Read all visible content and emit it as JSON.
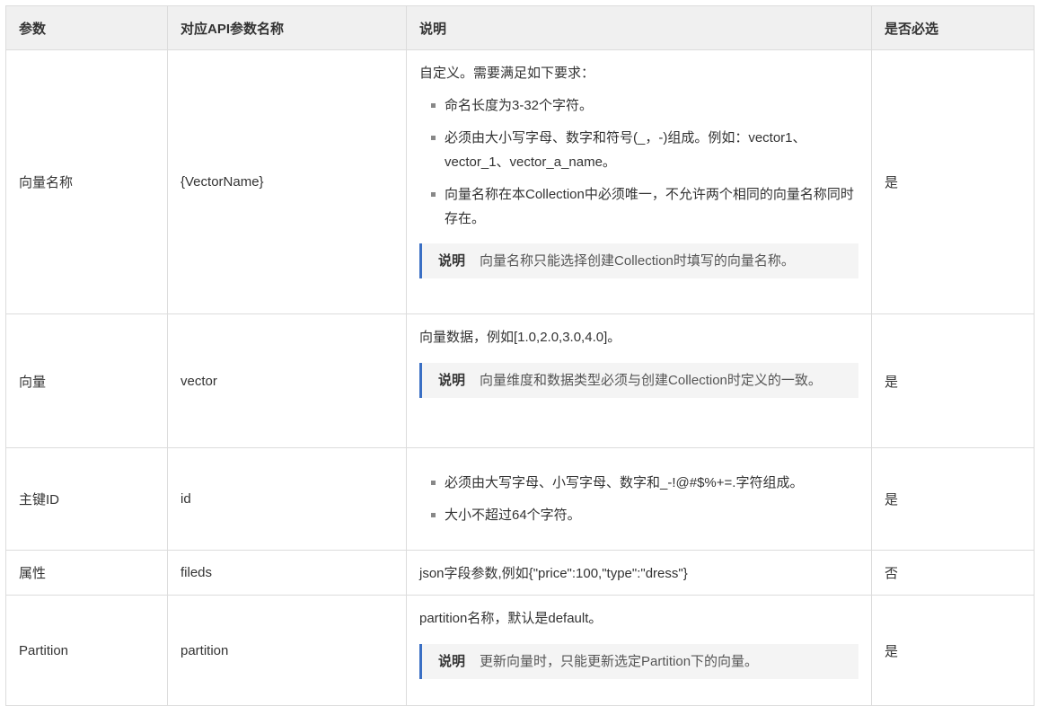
{
  "headers": [
    "参数",
    "对应API参数名称",
    "说明",
    "是否必选"
  ],
  "note_label": "说明",
  "rows": [
    {
      "param": "向量名称",
      "api": "{VectorName}",
      "intro": "自定义。需要满足如下要求：",
      "bullets": [
        "命名长度为3-32个字符。",
        "必须由大小写字母、数字和符号(_，-)组成。例如：vector1、vector_1、vector_a_name。",
        "向量名称在本Collection中必须唯一，不允许两个相同的向量名称同时存在。"
      ],
      "note": "向量名称只能选择创建Collection时填写的向量名称。",
      "required": "是"
    },
    {
      "param": "向量",
      "api": "vector",
      "intro": "向量数据，例如[1.0,2.0,3.0,4.0]。",
      "note": "向量维度和数据类型必须与创建Collection时定义的一致。",
      "required": "是"
    },
    {
      "param": "主键ID",
      "api": "id",
      "bullets": [
        "必须由大写字母、小写字母、数字和_-!@#$%+=.字符组成。",
        "大小不超过64个字符。"
      ],
      "required": "是"
    },
    {
      "param": "属性",
      "api": "fileds",
      "intro": "json字段参数,例如{\"price\":100,\"type\":\"dress\"}",
      "required": "否"
    },
    {
      "param": "Partition",
      "api": "partition",
      "intro": "partition名称，默认是default。",
      "note": "更新向量时，只能更新选定Partition下的向量。",
      "required": "是"
    }
  ]
}
